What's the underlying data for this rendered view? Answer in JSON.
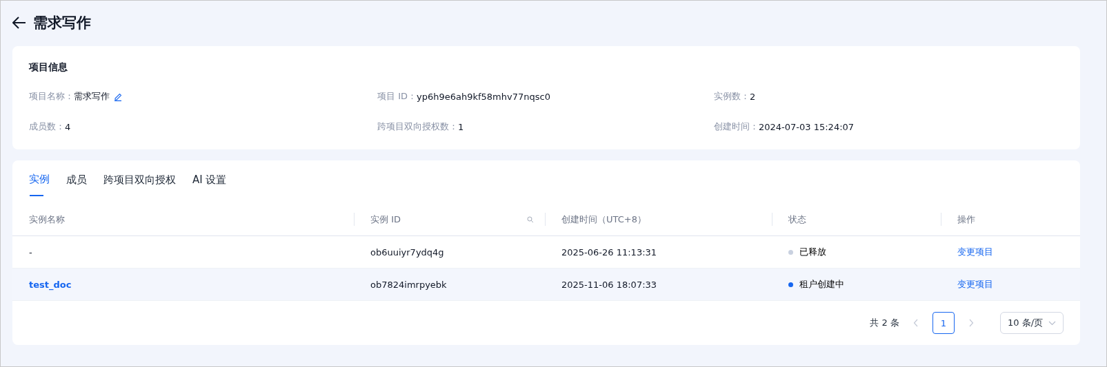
{
  "header": {
    "title": "需求写作"
  },
  "info": {
    "title": "项目信息",
    "fields": [
      {
        "label": "项目名称：",
        "value": "需求写作",
        "editable": true
      },
      {
        "label": "项目 ID：",
        "value": "yp6h9e6ah9kf58mhv77nqsc0",
        "editable": false
      },
      {
        "label": "实例数：",
        "value": "2",
        "editable": false
      },
      {
        "label": "成员数：",
        "value": "4",
        "editable": false
      },
      {
        "label": "跨项目双向授权数：",
        "value": "1",
        "editable": false
      },
      {
        "label": "创建时间：",
        "value": "2024-07-03 15:24:07",
        "editable": false
      }
    ]
  },
  "tabs": [
    {
      "label": "实例",
      "selected": true
    },
    {
      "label": "成员",
      "selected": false
    },
    {
      "label": "跨项目双向授权",
      "selected": false
    },
    {
      "label": "AI 设置",
      "selected": false
    }
  ],
  "table": {
    "columns": [
      {
        "label": "实例名称",
        "searchable": false
      },
      {
        "label": "实例 ID",
        "searchable": true
      },
      {
        "label": "创建时间（UTC+8）",
        "searchable": false
      },
      {
        "label": "状态",
        "searchable": false
      },
      {
        "label": "操作",
        "searchable": false
      }
    ],
    "rows": [
      {
        "name": "-",
        "kind": "text",
        "id": "ob6uuiyr7ydq4g",
        "created": "2025-06-26 11:13:31",
        "status": "已释放",
        "color": "#c9d1e0",
        "action": "变更项目",
        "hovered": false
      },
      {
        "name": "test_doc",
        "kind": "link",
        "id": "ob7824imrpyebk",
        "created": "2025-11-06 18:07:33",
        "status": "租户创建中",
        "color": "#1666f0",
        "action": "变更项目",
        "hovered": true
      }
    ]
  },
  "pagination": {
    "total": "共 2 条",
    "prev_disabled": true,
    "next_disabled": true,
    "pages": [
      {
        "label": "1",
        "selected": true
      }
    ],
    "page_size": "10 条/页"
  }
}
